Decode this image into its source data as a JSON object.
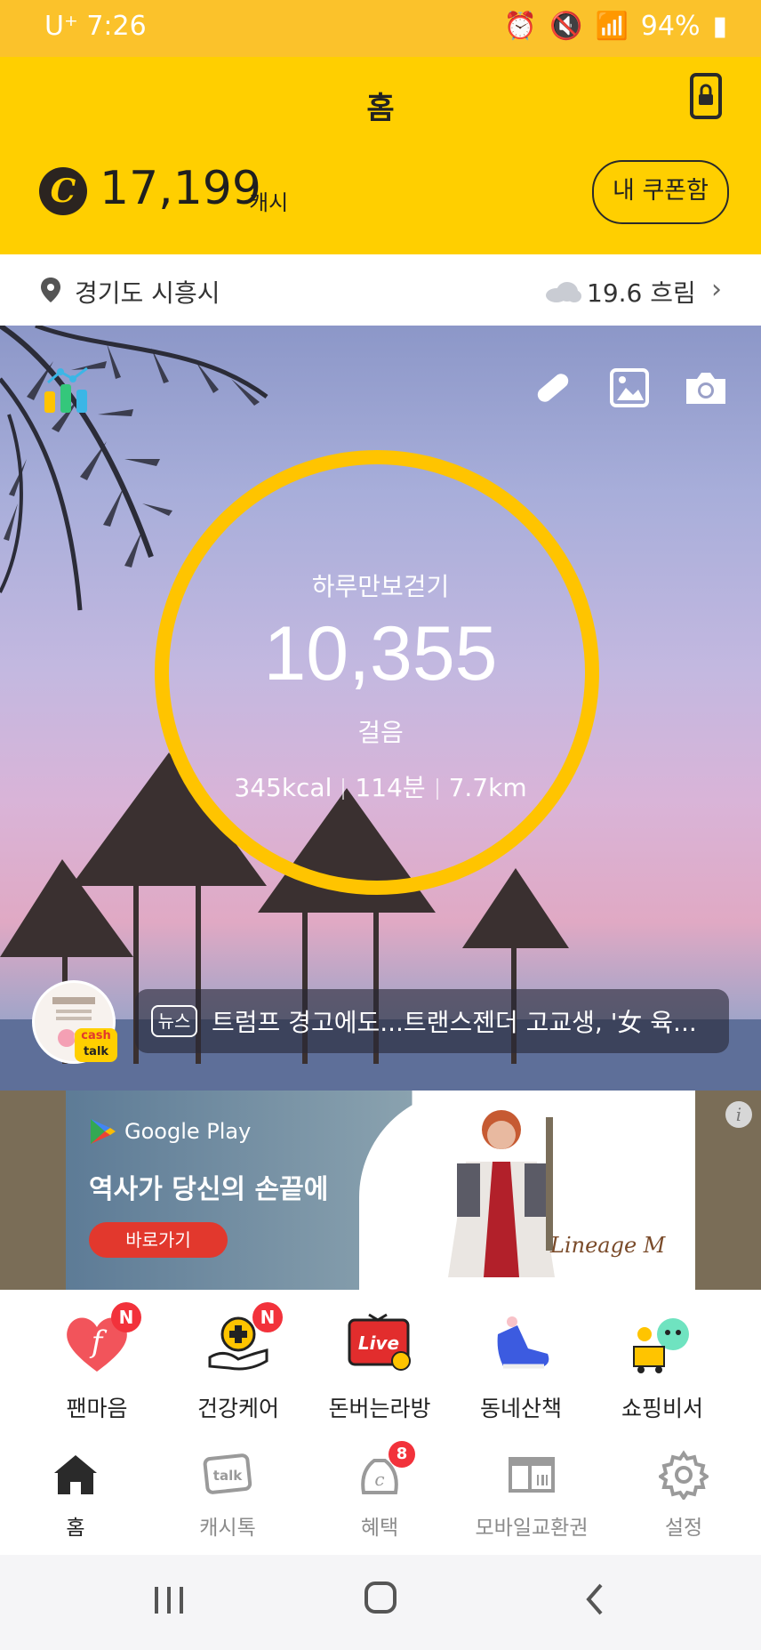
{
  "status_bar": {
    "time": "U⁺ 7:26",
    "battery": "94%"
  },
  "header": {
    "title": "홈",
    "cash_symbol": "C",
    "cash_value": "17,199",
    "cash_unit": "캐시",
    "coupon_button": "내 쿠폰함"
  },
  "location": {
    "place": "경기도 시흥시",
    "weather": "19.6 흐림"
  },
  "pedometer": {
    "title": "하루만보걷기",
    "steps": "10,355",
    "unit": "걸음",
    "kcal": "345kcal",
    "minutes": "114분",
    "distance": "7.7km",
    "ring_progress": 1.0
  },
  "news": {
    "badge": "뉴스",
    "headline": "트럼프 경고에도...트랜스젠더 고교생, '女 육...",
    "avatar_tag_1": "cash",
    "avatar_tag_2": "talk"
  },
  "ad": {
    "store": "Google Play",
    "title": "역사가 당신의 손끝에",
    "button": "바로가기",
    "logo": "Lineage M",
    "info": "i"
  },
  "shortcuts": [
    {
      "label": "팬마음",
      "badge": "N",
      "icon": "heart-f-icon"
    },
    {
      "label": "건강케어",
      "badge": "N",
      "icon": "health-care-icon"
    },
    {
      "label": "돈버는라방",
      "badge": "",
      "icon": "live-tv-icon"
    },
    {
      "label": "동네산책",
      "badge": "",
      "icon": "sneaker-icon"
    },
    {
      "label": "쇼핑비서",
      "badge": "",
      "icon": "shopping-assistant-icon"
    }
  ],
  "tabs": [
    {
      "label": "홈",
      "icon": "home-icon",
      "active": true
    },
    {
      "label": "캐시톡",
      "icon": "cashtalk-icon"
    },
    {
      "label": "혜택",
      "icon": "benefit-icon",
      "count": "8"
    },
    {
      "label": "모바일교환권",
      "icon": "mobile-voucher-icon"
    },
    {
      "label": "설정",
      "icon": "settings-gear-icon"
    }
  ],
  "colors": {
    "brand_yellow": "#FFCF00",
    "ring": "#FFC400",
    "badge_red": "#F2323B"
  }
}
